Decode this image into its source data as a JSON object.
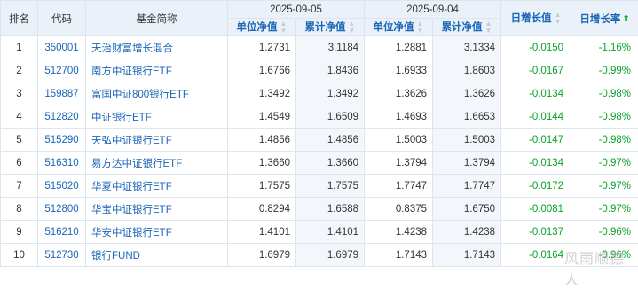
{
  "header": {
    "rank": "排名",
    "code": "代码",
    "name": "基金简称",
    "date1": "2025-09-05",
    "date2": "2025-09-04",
    "unit_nav": "单位净值",
    "acc_nav": "累计净值",
    "daily_change_value": "日增长值",
    "daily_change_rate": "日增长率"
  },
  "rows": [
    {
      "rank": "1",
      "code": "350001",
      "name": "天治财富增长混合",
      "unav1": "1.2731",
      "anav1": "3.1184",
      "unav2": "1.2881",
      "anav2": "3.1334",
      "chg": "-0.0150",
      "rate": "-1.16%"
    },
    {
      "rank": "2",
      "code": "512700",
      "name": "南方中证银行ETF",
      "unav1": "1.6766",
      "anav1": "1.8436",
      "unav2": "1.6933",
      "anav2": "1.8603",
      "chg": "-0.0167",
      "rate": "-0.99%"
    },
    {
      "rank": "3",
      "code": "159887",
      "name": "富国中证800银行ETF",
      "unav1": "1.3492",
      "anav1": "1.3492",
      "unav2": "1.3626",
      "anav2": "1.3626",
      "chg": "-0.0134",
      "rate": "-0.98%"
    },
    {
      "rank": "4",
      "code": "512820",
      "name": "中证银行ETF",
      "unav1": "1.4549",
      "anav1": "1.6509",
      "unav2": "1.4693",
      "anav2": "1.6653",
      "chg": "-0.0144",
      "rate": "-0.98%"
    },
    {
      "rank": "5",
      "code": "515290",
      "name": "天弘中证银行ETF",
      "unav1": "1.4856",
      "anav1": "1.4856",
      "unav2": "1.5003",
      "anav2": "1.5003",
      "chg": "-0.0147",
      "rate": "-0.98%"
    },
    {
      "rank": "6",
      "code": "516310",
      "name": "易方达中证银行ETF",
      "unav1": "1.3660",
      "anav1": "1.3660",
      "unav2": "1.3794",
      "anav2": "1.3794",
      "chg": "-0.0134",
      "rate": "-0.97%"
    },
    {
      "rank": "7",
      "code": "515020",
      "name": "华夏中证银行ETF",
      "unav1": "1.7575",
      "anav1": "1.7575",
      "unav2": "1.7747",
      "anav2": "1.7747",
      "chg": "-0.0172",
      "rate": "-0.97%"
    },
    {
      "rank": "8",
      "code": "512800",
      "name": "华宝中证银行ETF",
      "unav1": "0.8294",
      "anav1": "1.6588",
      "unav2": "0.8375",
      "anav2": "1.6750",
      "chg": "-0.0081",
      "rate": "-0.97%"
    },
    {
      "rank": "9",
      "code": "516210",
      "name": "华安中证银行ETF",
      "unav1": "1.4101",
      "anav1": "1.4101",
      "unav2": "1.4238",
      "anav2": "1.4238",
      "chg": "-0.0137",
      "rate": "-0.96%"
    },
    {
      "rank": "10",
      "code": "512730",
      "name": "银行FUND",
      "unav1": "1.6979",
      "anav1": "1.6979",
      "unav2": "1.7143",
      "anav2": "1.7143",
      "chg": "-0.0164",
      "rate": "-0.96%"
    }
  ],
  "watermark": "风雨顺德人",
  "colors": {
    "link": "#1a66b8",
    "negative": "#07a327",
    "header_bg": "#eaf1f8"
  }
}
